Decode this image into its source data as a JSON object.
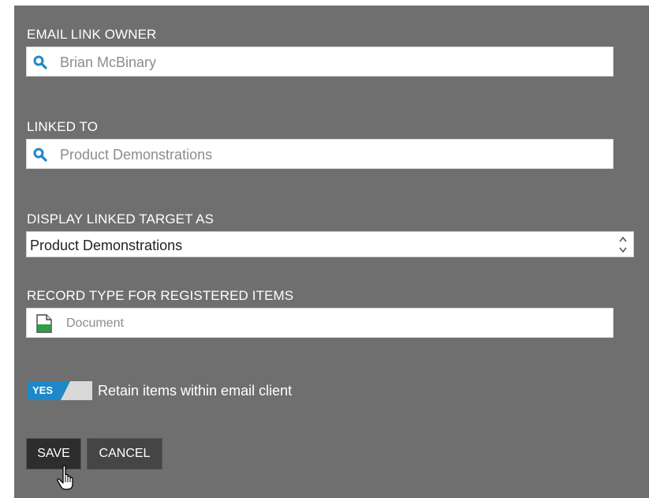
{
  "owner": {
    "label": "EMAIL LINK OWNER",
    "value": "Brian McBinary",
    "icon": "search-icon"
  },
  "linked": {
    "label": "LINKED TO",
    "value": "Product Demonstrations",
    "icon": "search-icon"
  },
  "display": {
    "label": "DISPLAY LINKED TARGET AS",
    "selected": "Product Demonstrations"
  },
  "record": {
    "label": "RECORD TYPE FOR REGISTERED ITEMS",
    "value": "Document",
    "icon": "document-icon"
  },
  "retain": {
    "toggle_text": "YES",
    "label": "Retain items within email client",
    "on": true
  },
  "buttons": {
    "save": "SAVE",
    "cancel": "CANCEL"
  },
  "colors": {
    "panel": "#6f6f6f",
    "accent": "#1e88c8",
    "doc_green": "#2e9e4a"
  }
}
